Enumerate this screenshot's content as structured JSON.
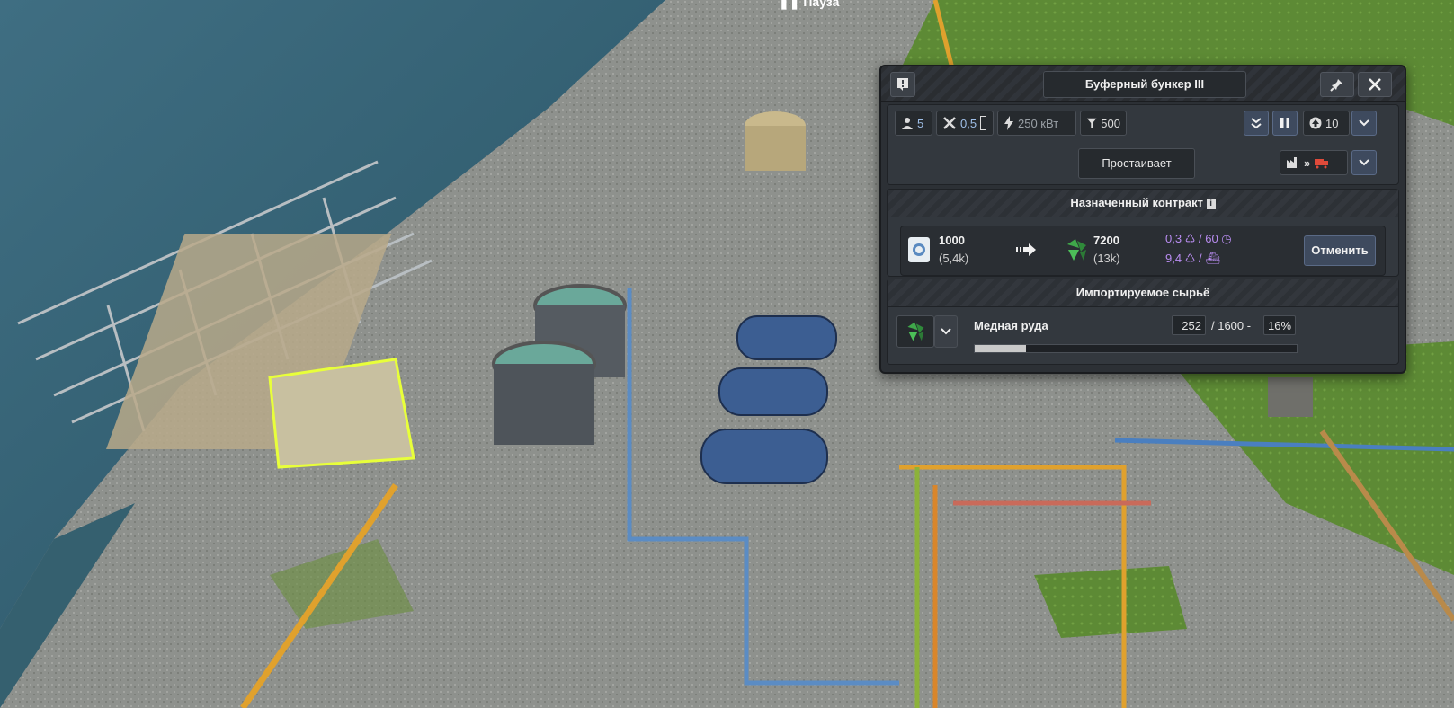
{
  "hud_top": {
    "label": "Пауза"
  },
  "window": {
    "title": "Буферный бункер III",
    "stats": {
      "workers": "5",
      "maintenance": "0,5",
      "power": "250 кВт",
      "capacity": "500",
      "priority": "10"
    },
    "status": "Простаивает",
    "contract": {
      "header": "Назначенный контракт",
      "give_amount": "1000",
      "give_sub": "(5,4k)",
      "get_amount": "7200",
      "get_sub": "(13k)",
      "rate1": "0,3",
      "rate1_suffix": "/ 60",
      "rate2": "9,4",
      "cancel_label": "Отменить"
    },
    "import": {
      "header": "Импортируемое сырьё",
      "product_name": "Медная руда",
      "current": "252",
      "total": "/ 1600 -",
      "percent": "16%",
      "fill_ratio": 0.16
    }
  },
  "colors": {
    "panel": "#2c3035",
    "accent_purple": "#b88cf0",
    "button_blue": "#3e4a5e",
    "ore_green": "#3fa84a"
  }
}
